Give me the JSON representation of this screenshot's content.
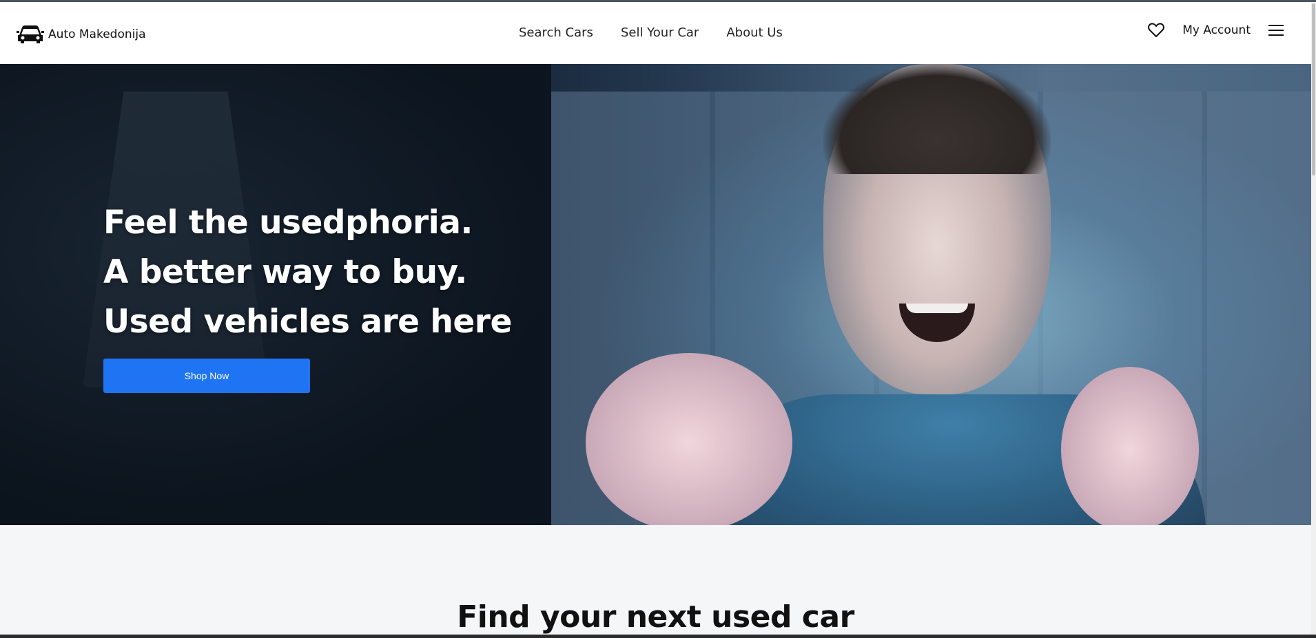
{
  "brand": {
    "name": "Auto Makedonija",
    "icon": "car-icon"
  },
  "nav": {
    "links": [
      {
        "label": "Search Cars"
      },
      {
        "label": "Sell Your Car"
      },
      {
        "label": "About Us"
      }
    ],
    "favorites_icon": "heart-icon",
    "account_label": "My Account",
    "menu_icon": "hamburger-menu-icon"
  },
  "hero": {
    "lines": [
      "Feel the usedphoria.",
      "A better way to buy.",
      "Used vehicles are here"
    ],
    "cta_label": "Shop Now",
    "cta_color": "#1f74f4"
  },
  "section": {
    "title": "Find your next used car"
  }
}
